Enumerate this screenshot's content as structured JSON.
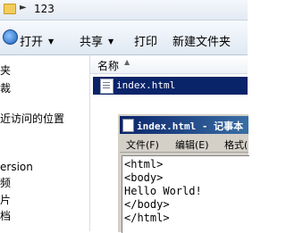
{
  "address": {
    "path": "123"
  },
  "toolbar": {
    "open_label": "打开",
    "share_label": "共享",
    "print_label": "打印",
    "new_folder_label": "新建文件夹"
  },
  "nav": {
    "items": [
      "夹",
      "裁",
      "近访问的位置",
      "ersion",
      "频",
      "片",
      "档"
    ]
  },
  "file_list": {
    "column_name": "名称",
    "files": [
      {
        "name": "index.html",
        "selected": true
      }
    ]
  },
  "notepad": {
    "title": "index.html - 记事本",
    "menu": [
      "文件(F)",
      "编辑(E)",
      "格式("
    ],
    "content": [
      "<html>",
      "<body>",
      "Hello World!",
      "</body>",
      "</html>"
    ]
  },
  "colors": {
    "selection": "#0a246a",
    "title_bar": "#0a246a"
  },
  "icons": [
    "folder-icon",
    "chevron-right-icon",
    "open-icon",
    "html-file-icon",
    "notepad-icon"
  ]
}
